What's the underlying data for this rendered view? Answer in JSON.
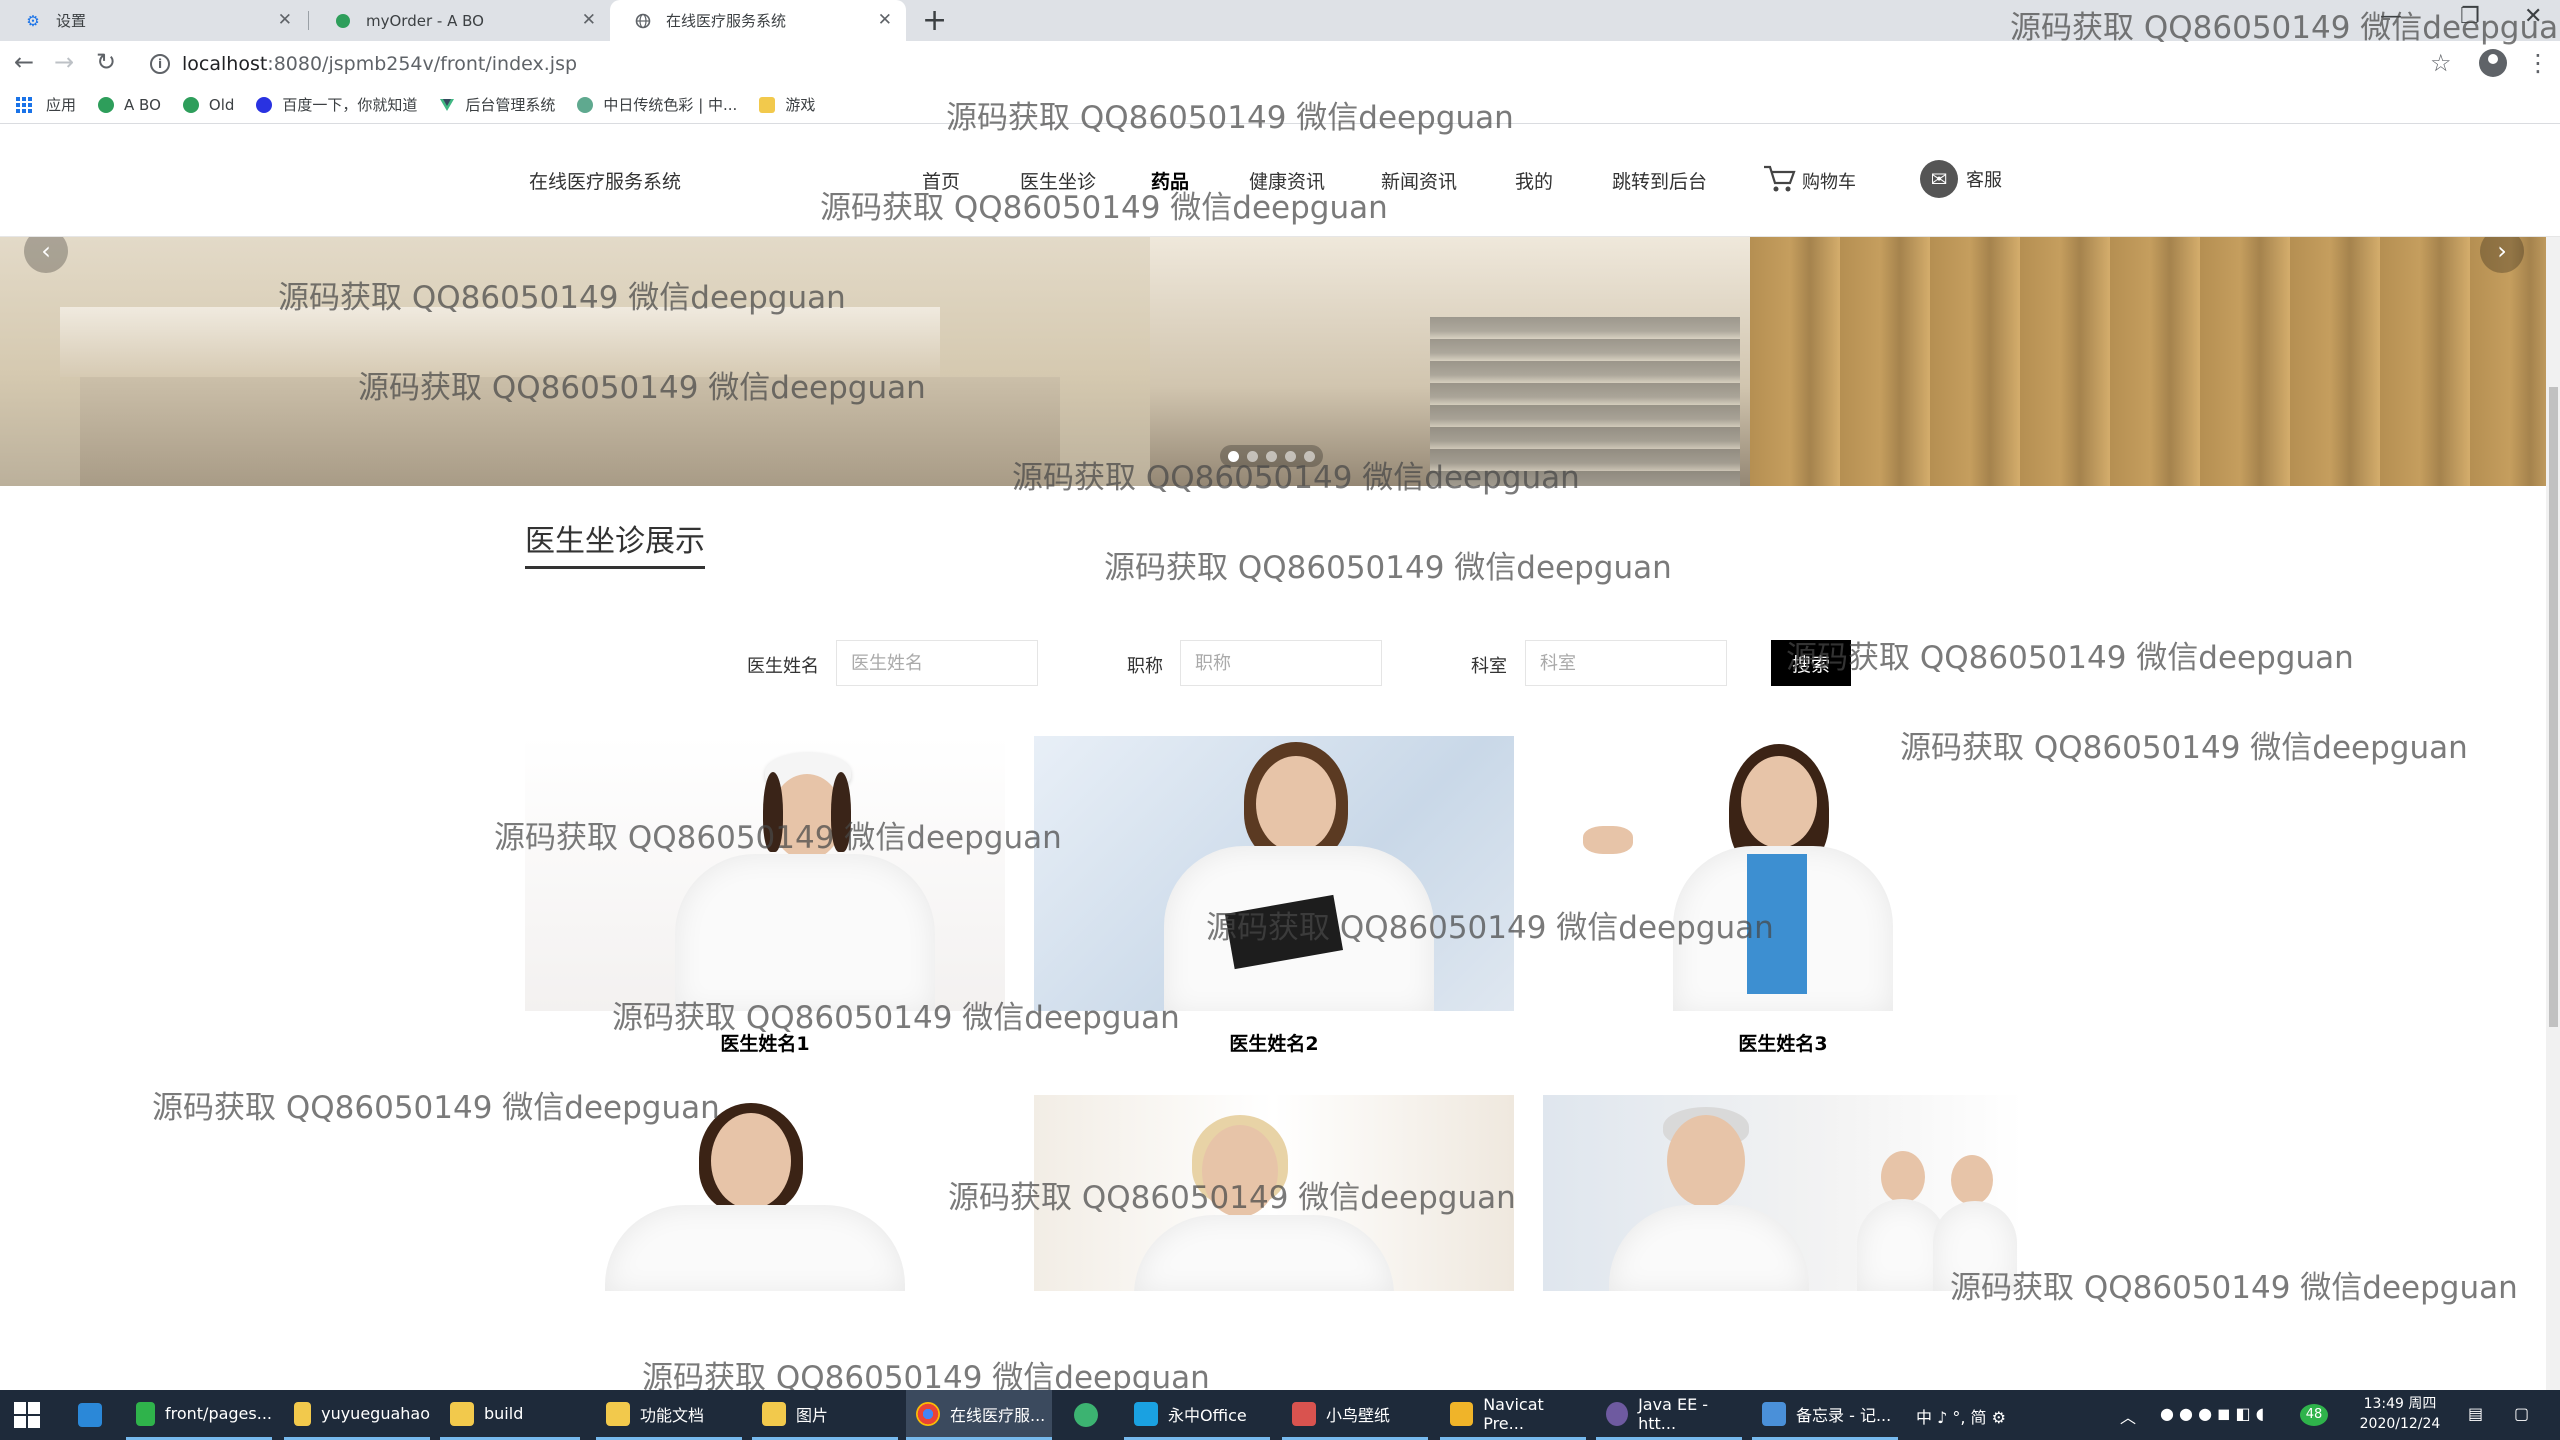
{
  "browser": {
    "tabs": [
      {
        "label": "设置",
        "icon": "gear-icon"
      },
      {
        "label": "myOrder - A BO",
        "icon": "site-icon"
      },
      {
        "label": "在线医疗服务系统",
        "icon": "globe-icon"
      }
    ],
    "url_host": "localhost",
    "url_path": ":8080/jspmb254v/front/index.jsp",
    "bookmarks": [
      {
        "label": "应用"
      },
      {
        "label": "A BO"
      },
      {
        "label": "Old"
      },
      {
        "label": "百度一下，你就知道"
      },
      {
        "label": "后台管理系统"
      },
      {
        "label": "中日传统色彩 | 中..."
      },
      {
        "label": "游戏"
      }
    ]
  },
  "site": {
    "logo": "在线医疗服务系统",
    "nav": [
      "首页",
      "医生坐诊",
      "药品",
      "健康资讯",
      "新闻资讯",
      "我的",
      "跳转到后台"
    ],
    "cart_label": "购物车",
    "service_label": "客服"
  },
  "banner": {
    "slide_count": 5,
    "active_slide": 1
  },
  "section": {
    "title": "医生坐诊展示"
  },
  "search": {
    "name_label": "医生姓名",
    "name_placeholder": "医生姓名",
    "title_label": "职称",
    "title_placeholder": "职称",
    "dept_label": "科室",
    "dept_placeholder": "科室",
    "button": "搜索"
  },
  "doctors": [
    {
      "name": "医生姓名1"
    },
    {
      "name": "医生姓名2"
    },
    {
      "name": "医生姓名3"
    }
  ],
  "watermark": "源码获取 QQ86050149 微信deepguan",
  "taskbar": {
    "items": [
      "front/pages...",
      "yuyueguahao",
      "build",
      "功能文档",
      "图片",
      "在线医疗服...",
      "",
      "永中Office",
      "小鸟壁纸",
      "Navicat Pre...",
      "Java EE - htt...",
      "备忘录 - 记..."
    ],
    "tray_text": "中 ♪ °, 简 ⚙",
    "time": "13:49 周四",
    "date": "2020/12/24"
  },
  "colors": {
    "search_button": "#000000",
    "taskbar": "#1e2a3a",
    "tab_strip": "#dee1e6"
  }
}
